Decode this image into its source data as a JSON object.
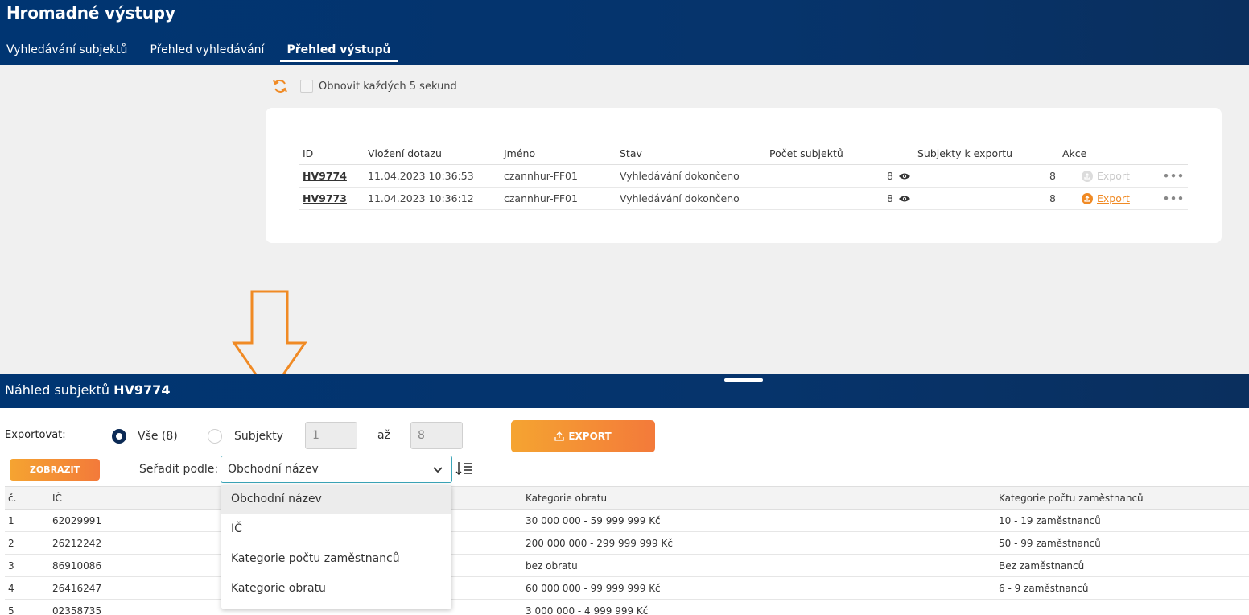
{
  "header": {
    "title": "Hromadné výstupy",
    "tabs": [
      {
        "label": "Vyhledávání subjektů"
      },
      {
        "label": "Přehled vyhledávání"
      },
      {
        "label": "Přehled výstupů"
      }
    ]
  },
  "refresh": {
    "label": "Obnovit každých 5 sekund",
    "checked": false
  },
  "outputs": {
    "columns": [
      "ID",
      "Vložení dotazu",
      "Jméno",
      "Stav",
      "Počet subjektů",
      "Subjekty k exportu",
      "Akce"
    ],
    "rows": [
      {
        "id": "HV9774",
        "inserted": "11.04.2023 10:36:53",
        "name": "czannhur-FF01",
        "status": "Vyhledávání dokončeno",
        "count": "8",
        "to_export": "8",
        "export_label": "Export",
        "export_enabled": false
      },
      {
        "id": "HV9773",
        "inserted": "11.04.2023 10:36:12",
        "name": "czannhur-FF01",
        "status": "Vyhledávání dokončeno",
        "count": "8",
        "to_export": "8",
        "export_label": "Export",
        "export_enabled": true
      }
    ]
  },
  "preview": {
    "title_prefix": "Náhled subjektů",
    "title_id": "HV9774",
    "export_label": "Exportovat:",
    "option_all": "Vše (8)",
    "option_subjects": "Subjekty",
    "from_value": "1",
    "to_label": "až",
    "to_value": "8",
    "export_button": "EXPORT",
    "show_button": "ZOBRAZIT",
    "sort_label": "Seřadit podle:",
    "sort_value": "Obchodní název",
    "sort_options": [
      "Obchodní název",
      "IČ",
      "Kategorie počtu zaměstnanců",
      "Kategorie obratu"
    ]
  },
  "subjects": {
    "columns": [
      "č.",
      "IČ",
      "Kategorie obratu",
      "Kategorie počtu zaměstnanců"
    ],
    "rows": [
      {
        "n": "1",
        "ic": "62029991",
        "turnover": "30 000 000 - 59 999 999 Kč",
        "employees": "10 - 19 zaměstnanců"
      },
      {
        "n": "2",
        "ic": "26212242",
        "turnover": "200 000 000 - 299 999 999 Kč",
        "employees": "50 - 99 zaměstnanců"
      },
      {
        "n": "3",
        "ic": "86910086",
        "turnover": "bez obratu",
        "employees": "Bez zaměstnanců"
      },
      {
        "n": "4",
        "ic": "26416247",
        "turnover": "60 000 000 - 99 999 999 Kč",
        "employees": "6 - 9 zaměstnanců"
      },
      {
        "n": "5",
        "ic": "02358735",
        "turnover": "3 000 000 - 4 999 999 Kč",
        "employees": ""
      }
    ]
  },
  "colors": {
    "accent": "#f08a24",
    "navy": "#003572"
  }
}
